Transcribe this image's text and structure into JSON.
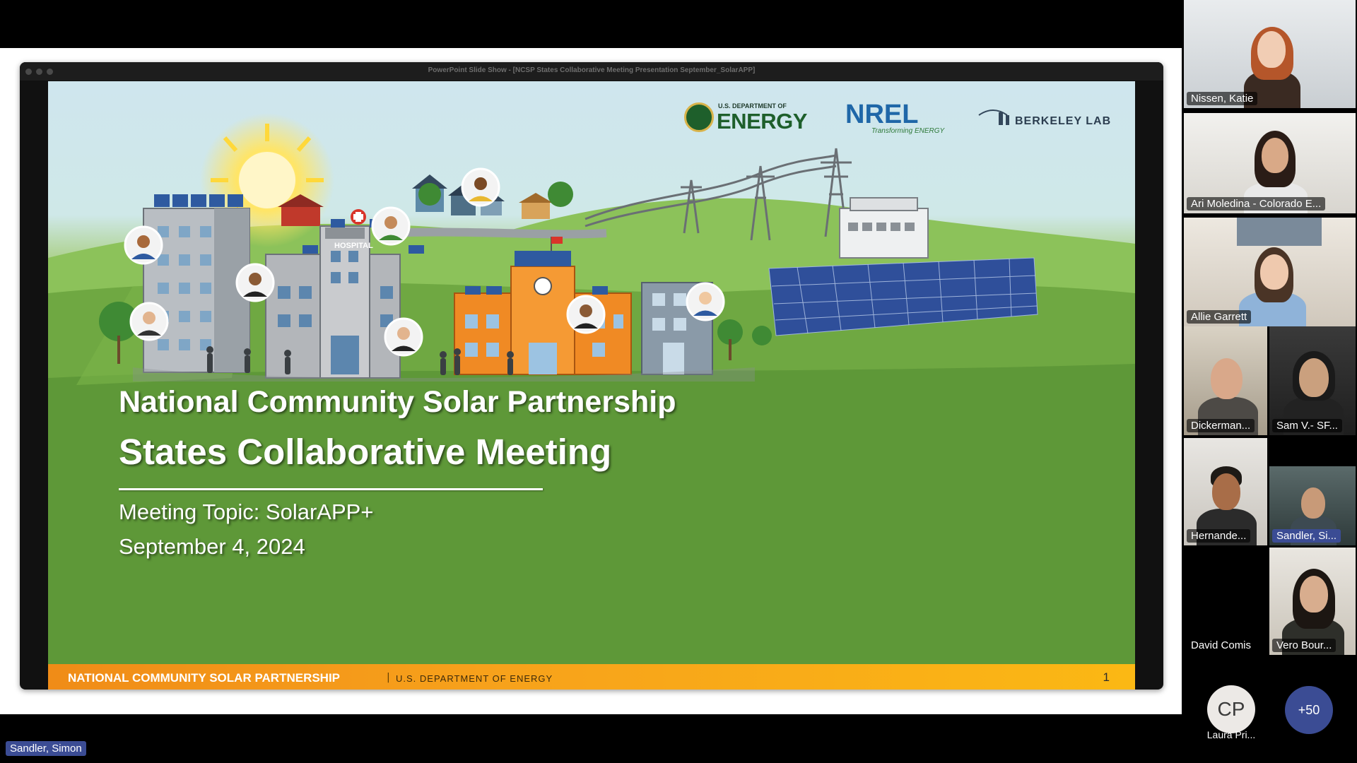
{
  "window": {
    "title": "PowerPoint Slide Show - [NCSP States Collaborative Meeting Presentation September_SolarAPP]"
  },
  "slide": {
    "logos": {
      "doe_top": "U.S. DEPARTMENT OF",
      "doe_main": "ENERGY",
      "nrel_main": "NREL",
      "nrel_tag": "Transforming ENERGY",
      "berkeley": "BERKELEY LAB"
    },
    "illustration": {
      "hospital_sign": "HOSPITAL"
    },
    "title_line1": "National Community Solar Partnership",
    "title_line2": "States Collaborative Meeting",
    "topic": "Meeting Topic: SolarAPP+",
    "date": "September 4, 2024",
    "footer": {
      "left": "NATIONAL COMMUNITY SOLAR PARTNERSHIP",
      "separator": "|",
      "middle": "U.S. DEPARTMENT OF ENERGY",
      "page": "1"
    }
  },
  "presenter": {
    "label": "Sandler, Simon"
  },
  "participants": [
    {
      "name": "Nissen, Katie"
    },
    {
      "name": "Ari Moledina - Colorado E..."
    },
    {
      "name": "Allie Garrett"
    },
    {
      "name": "Dickerman..."
    },
    {
      "name": "Sam V.- SF..."
    },
    {
      "name": "Hernande..."
    },
    {
      "name": "Sandler, Si..."
    },
    {
      "name": "David Comis"
    },
    {
      "name": "Vero Bour..."
    },
    {
      "name": "Laura Pri...",
      "initials": "CP"
    }
  ],
  "more_participants": "+50",
  "colors": {
    "accent": "#3b4c94",
    "footer_orange": "#f7a11b",
    "doe_green": "#1e5f2b",
    "nrel_blue": "#1f67a8"
  }
}
